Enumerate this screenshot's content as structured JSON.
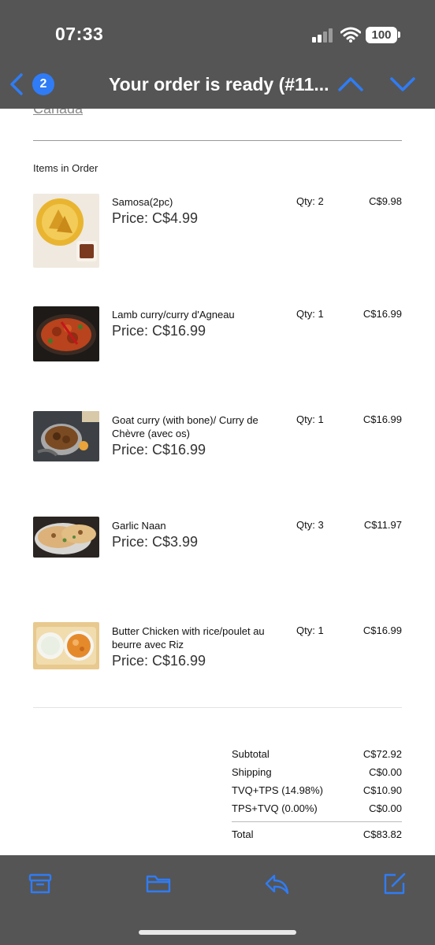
{
  "status_bar": {
    "time": "07:33",
    "battery": "100",
    "icons": [
      "signal-icon",
      "wifi-icon",
      "battery-icon"
    ]
  },
  "nav": {
    "back_icon": "chevron-left-icon",
    "unread_count": "2",
    "title": "Your order is ready (#11...",
    "prev_icon": "chevron-up-icon",
    "next_icon": "chevron-down-icon"
  },
  "address": {
    "country": "Canada"
  },
  "order": {
    "section_label": "Items in Order",
    "items": [
      {
        "name": "Samosa(2pc)",
        "price": "Price: C$4.99",
        "qty": "Qty: 2",
        "total": "C$9.98"
      },
      {
        "name": "Lamb curry/curry d'Agneau",
        "price": "Price: C$16.99",
        "qty": "Qty: 1",
        "total": "C$16.99"
      },
      {
        "name": "Goat curry (with bone)/ Curry de Chèvre (avec os)",
        "price": "Price: C$16.99",
        "qty": "Qty: 1",
        "total": "C$16.99"
      },
      {
        "name": "Garlic Naan",
        "price": "Price: C$3.99",
        "qty": "Qty: 3",
        "total": "C$11.97"
      },
      {
        "name": "Butter Chicken with rice/poulet au beurre avec Riz",
        "price": "Price: C$16.99",
        "qty": "Qty: 1",
        "total": "C$16.99"
      }
    ]
  },
  "totals": {
    "rows": [
      {
        "label": "Subtotal",
        "value": "C$72.92"
      },
      {
        "label": "Shipping",
        "value": "C$0.00"
      },
      {
        "label": "TVQ+TPS (14.98%)",
        "value": "C$10.90"
      },
      {
        "label": "TPS+TVQ (0.00%)",
        "value": "C$0.00"
      }
    ],
    "total": {
      "label": "Total",
      "value": "C$83.82"
    }
  },
  "toolbar": {
    "icons": [
      "archive-icon",
      "folder-icon",
      "reply-icon",
      "compose-icon"
    ]
  },
  "colors": {
    "accent": "#2f7cf6",
    "chrome": "#555555"
  }
}
